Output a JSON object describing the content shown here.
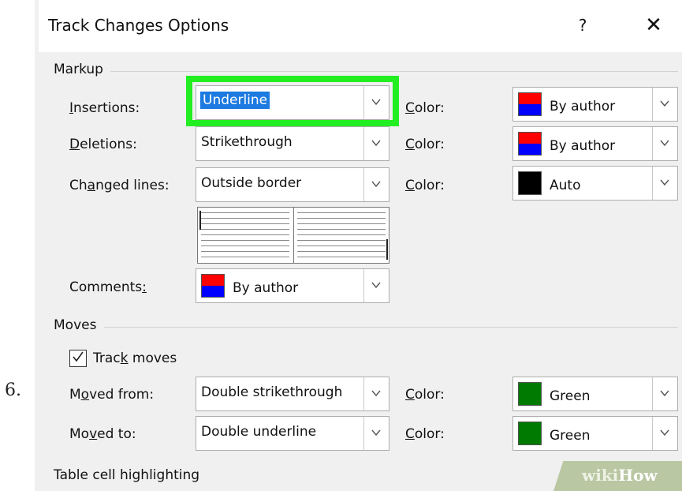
{
  "step_number": "6.",
  "dialog": {
    "title": "Track Changes Options",
    "help_label": "?",
    "close_label": "✕"
  },
  "markup": {
    "group_label": "Markup",
    "insertions": {
      "label_pre": "",
      "label_key": "I",
      "label_post": "nsertions:",
      "value": "Underline",
      "color_label_key": "C",
      "color_label_post": "olor:",
      "color_value": "By author",
      "swatch": [
        "#ff0000",
        "#0000ff"
      ]
    },
    "deletions": {
      "label_pre": "",
      "label_key": "D",
      "label_post": "eletions:",
      "value": "Strikethrough",
      "color_label_key": "C",
      "color_label_post": "olor:",
      "color_value": "By author",
      "swatch": [
        "#ff0000",
        "#0000ff"
      ]
    },
    "changed_lines": {
      "label_pre": "Ch",
      "label_key": "a",
      "label_post": "nged lines:",
      "value": "Outside border",
      "color_label_key": "C",
      "color_label_post": "olor:",
      "color_value": "Auto",
      "swatch": [
        "#000000",
        "#000000"
      ]
    },
    "comments": {
      "label_pre": "Comments",
      "label_key": ":",
      "label_post": "",
      "value": "By author",
      "swatch": [
        "#ff0000",
        "#0000ff"
      ]
    }
  },
  "moves": {
    "group_label": "Moves",
    "track_moves": {
      "label_pre": "Trac",
      "label_key": "k",
      "label_post": " moves",
      "checked": true
    },
    "moved_from": {
      "label_pre": "M",
      "label_key": "o",
      "label_post": "ved from:",
      "value": "Double strikethrough",
      "color_label_key": "C",
      "color_label_post": "olor:",
      "color_value": "Green",
      "swatch": [
        "#007a00",
        "#007a00"
      ]
    },
    "moved_to": {
      "label_pre": "Mo",
      "label_key": "v",
      "label_post": "ed to:",
      "value": "Double underline",
      "color_label_key": "C",
      "color_label_post": "olor:",
      "color_value": "Green",
      "swatch": [
        "#007a00",
        "#007a00"
      ]
    }
  },
  "table_cell": {
    "group_label": "Table cell highlighting"
  },
  "watermark": {
    "wiki": "wiki",
    "how": "How"
  },
  "colors": {
    "selection": "#1d7ae0",
    "highlight": "#22ee22",
    "title_edge": "#2f6fb1"
  }
}
